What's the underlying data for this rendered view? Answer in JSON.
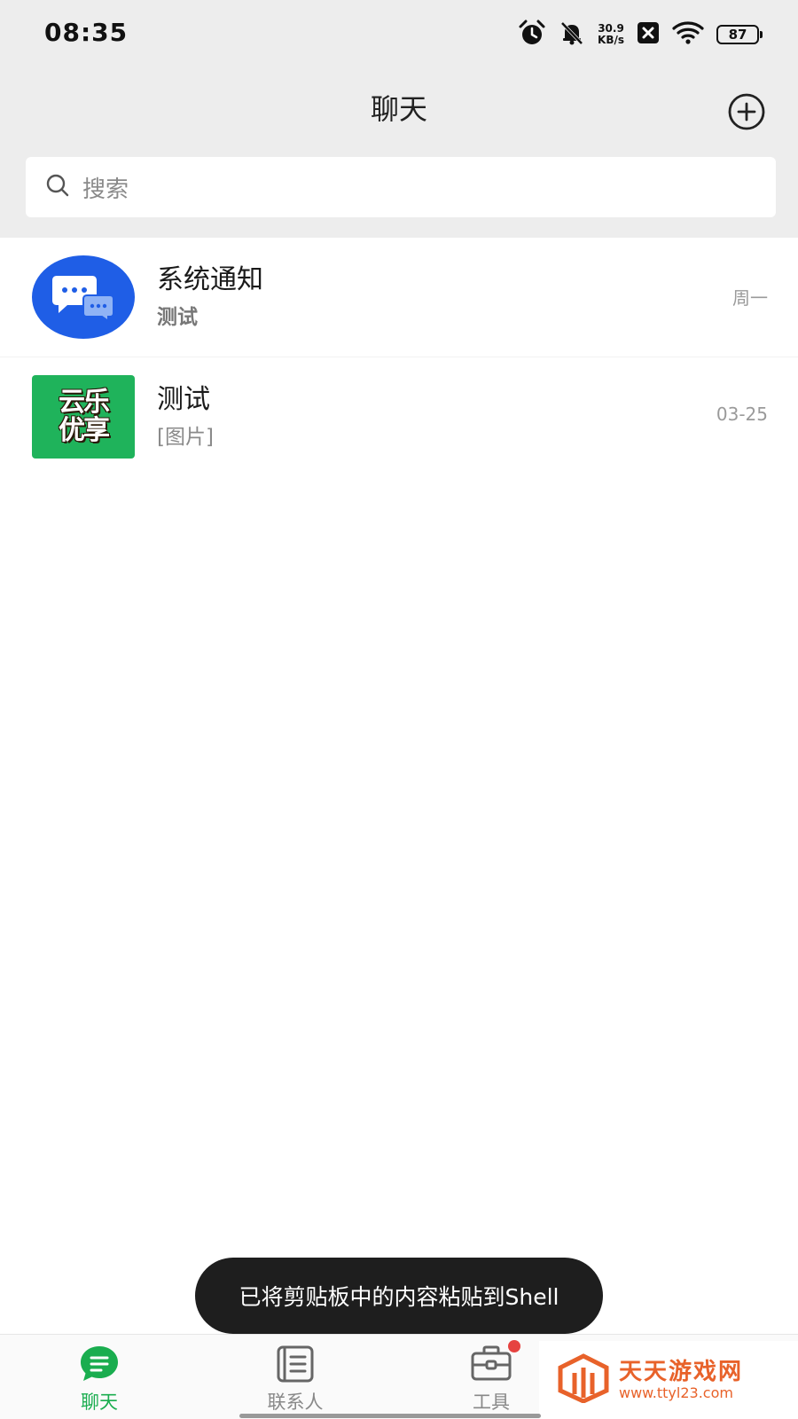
{
  "status_bar": {
    "time": "08:35",
    "net_speed_value": "30.9",
    "net_speed_unit": "KB/s",
    "battery": "87",
    "icons": [
      "alarm-icon",
      "mute-bell-icon",
      "sim-x-icon",
      "wifi-icon",
      "battery-icon"
    ]
  },
  "header": {
    "title": "聊天",
    "add_icon": "plus-circle-icon"
  },
  "search": {
    "placeholder": "搜索",
    "icon": "search-icon"
  },
  "chats": [
    {
      "name": "系统通知",
      "preview": "测试",
      "time": "周一",
      "avatar": "chat-bubbles-icon",
      "avatar_color": "#1f5ee6"
    },
    {
      "name": "测试",
      "preview": "[图片]",
      "time": "03-25",
      "avatar_text": [
        "云乐",
        "优享"
      ],
      "avatar_color": "#1fb35b"
    }
  ],
  "toast": {
    "message": "已将剪贴板中的内容粘贴到Shell"
  },
  "tabs": [
    {
      "label": "聊天",
      "icon": "chat-icon",
      "active": true
    },
    {
      "label": "联系人",
      "icon": "contacts-icon",
      "active": false
    },
    {
      "label": "工具",
      "icon": "toolbox-icon",
      "active": false,
      "badge": true
    }
  ],
  "watermark": {
    "name": "天天游戏网",
    "url": "www.ttyl23.com"
  },
  "colors": {
    "accent": "#1aad4f",
    "header_bg": "#ededed",
    "badge": "#e64340",
    "watermark": "#e8622a"
  }
}
